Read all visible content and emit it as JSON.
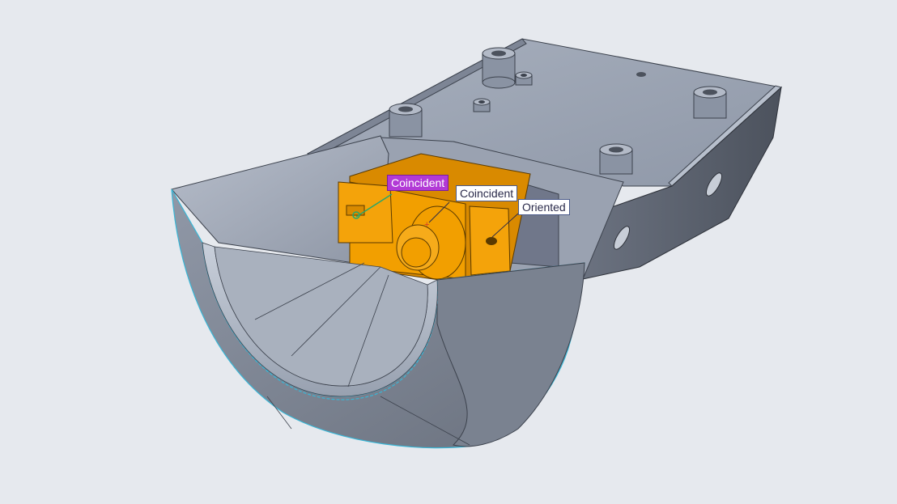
{
  "viewport": {
    "background": "#e6e9ee"
  },
  "constraints": [
    {
      "label": "Coincident",
      "state": "selected",
      "color": "#b23ad6"
    },
    {
      "label": "Coincident",
      "state": "normal",
      "color": "#ffffff"
    },
    {
      "label": "Oriented",
      "state": "normal",
      "color": "#ffffff"
    }
  ],
  "model": {
    "housing_color": "#8d96a6",
    "servo_color": "#f29f00",
    "edge_highlight_color": "#39b6d6"
  }
}
